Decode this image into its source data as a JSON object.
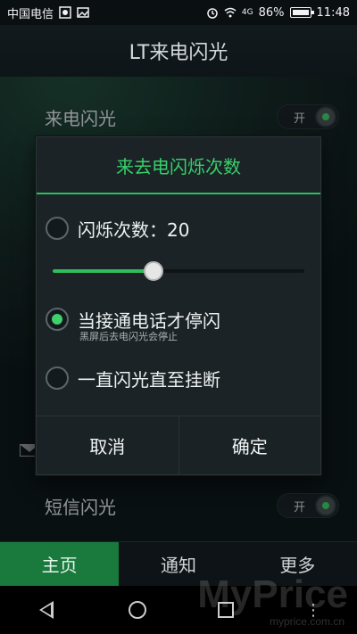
{
  "status_bar": {
    "carrier": "中国电信",
    "battery": "86%",
    "time": "11:48",
    "network": "4G"
  },
  "app": {
    "title": "LT来电闪光"
  },
  "settings": {
    "incoming_flash_label": "来电闪光",
    "incoming_toggle": "开",
    "sms_flash_label": "短信闪光",
    "sms_toggle": "开"
  },
  "dialog": {
    "title": "来去电闪烁次数",
    "option1_label": "闪烁次数：20",
    "option2_label": "当接通电话才停闪",
    "option2_sub": "黑屏后去电闪光会停止",
    "option3_label": "一直闪光直至挂断",
    "cancel": "取消",
    "confirm": "确定",
    "selected_option": 2,
    "flash_count": 20,
    "slider_fraction": 0.4
  },
  "tabs": [
    {
      "label": "主页",
      "active": true
    },
    {
      "label": "通知",
      "active": false
    },
    {
      "label": "更多",
      "active": false
    }
  ],
  "watermark": {
    "main": "MyPrice",
    "sub": "myprice.com.cn"
  },
  "colors": {
    "accent": "#37d06a",
    "tab_active": "#1a7a3d",
    "dialog_bg": "#1b2326"
  },
  "icons": {
    "wifi": "wifi-icon",
    "alarm": "alarm-icon",
    "mail": "mail-icon"
  }
}
